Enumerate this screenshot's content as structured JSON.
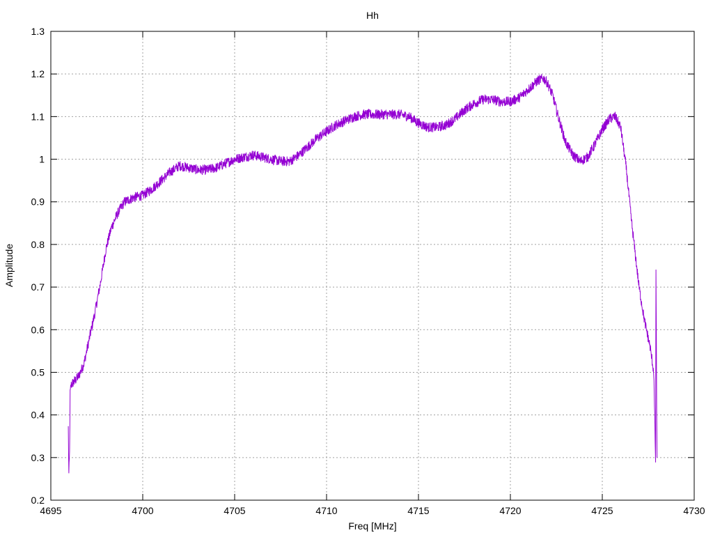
{
  "chart_data": {
    "type": "line",
    "title": "Hh",
    "xlabel": "Freq [MHz]",
    "ylabel": "Amplitude",
    "xlim": [
      4695,
      4730
    ],
    "ylim": [
      0.2,
      1.3
    ],
    "xticks": [
      4695,
      4700,
      4705,
      4710,
      4715,
      4720,
      4725,
      4730
    ],
    "xtick_labels": [
      "4695",
      "4700",
      "4705",
      "4710",
      "4715",
      "4720",
      "4725",
      "4730"
    ],
    "yticks": [
      0.2,
      0.3,
      0.4,
      0.5,
      0.6,
      0.7,
      0.8,
      0.9,
      1,
      1.1,
      1.2,
      1.3
    ],
    "ytick_labels": [
      "0.2",
      "0.3",
      "0.4",
      "0.5",
      "0.6",
      "0.7",
      "0.8",
      "0.9",
      "1",
      "1.1",
      "1.2",
      "1.3"
    ],
    "grid": true,
    "series": [
      {
        "color": "#9400d3",
        "noise_amplitude": 0.012,
        "x": [
          4695.95,
          4695.98,
          4696.02,
          4696.05,
          4696.1,
          4696.2,
          4696.3,
          4696.5,
          4696.8,
          4697.1,
          4697.4,
          4697.7,
          4698.0,
          4698.3,
          4698.6,
          4699.0,
          4699.5,
          4700.0,
          4700.5,
          4701.0,
          4701.5,
          4702.0,
          4702.5,
          4703.0,
          4703.5,
          4704.0,
          4704.5,
          4705.0,
          4705.5,
          4706.0,
          4706.5,
          4707.0,
          4707.5,
          4708.0,
          4708.5,
          4709.0,
          4709.5,
          4710.0,
          4710.5,
          4711.0,
          4711.5,
          4712.0,
          4712.5,
          4713.0,
          4713.5,
          4714.0,
          4714.5,
          4715.0,
          4715.5,
          4716.0,
          4716.5,
          4717.0,
          4717.5,
          4718.0,
          4718.5,
          4719.0,
          4719.5,
          4720.0,
          4720.5,
          4721.0,
          4721.5,
          4721.8,
          4722.0,
          4722.3,
          4722.6,
          4723.0,
          4723.4,
          4723.8,
          4724.2,
          4724.6,
          4725.0,
          4725.4,
          4725.7,
          4726.0,
          4726.3,
          4726.6,
          4727.0,
          4727.3,
          4727.6,
          4727.8,
          4727.9,
          4727.92,
          4727.94,
          4727.96,
          4727.98
        ],
        "y": [
          0.37,
          0.26,
          0.31,
          0.45,
          0.47,
          0.475,
          0.48,
          0.49,
          0.52,
          0.58,
          0.64,
          0.71,
          0.79,
          0.84,
          0.87,
          0.9,
          0.91,
          0.915,
          0.93,
          0.95,
          0.97,
          0.985,
          0.98,
          0.975,
          0.975,
          0.98,
          0.99,
          1.0,
          1.005,
          1.01,
          1.005,
          1.0,
          0.995,
          0.995,
          1.01,
          1.03,
          1.05,
          1.065,
          1.08,
          1.09,
          1.1,
          1.105,
          1.105,
          1.105,
          1.105,
          1.105,
          1.1,
          1.085,
          1.075,
          1.075,
          1.08,
          1.095,
          1.115,
          1.13,
          1.14,
          1.14,
          1.135,
          1.135,
          1.145,
          1.165,
          1.185,
          1.19,
          1.18,
          1.15,
          1.1,
          1.04,
          1.01,
          0.995,
          1.005,
          1.035,
          1.07,
          1.095,
          1.1,
          1.075,
          0.98,
          0.85,
          0.7,
          0.62,
          0.56,
          0.5,
          0.29,
          0.74,
          0.6,
          0.4,
          0.3
        ]
      }
    ]
  }
}
